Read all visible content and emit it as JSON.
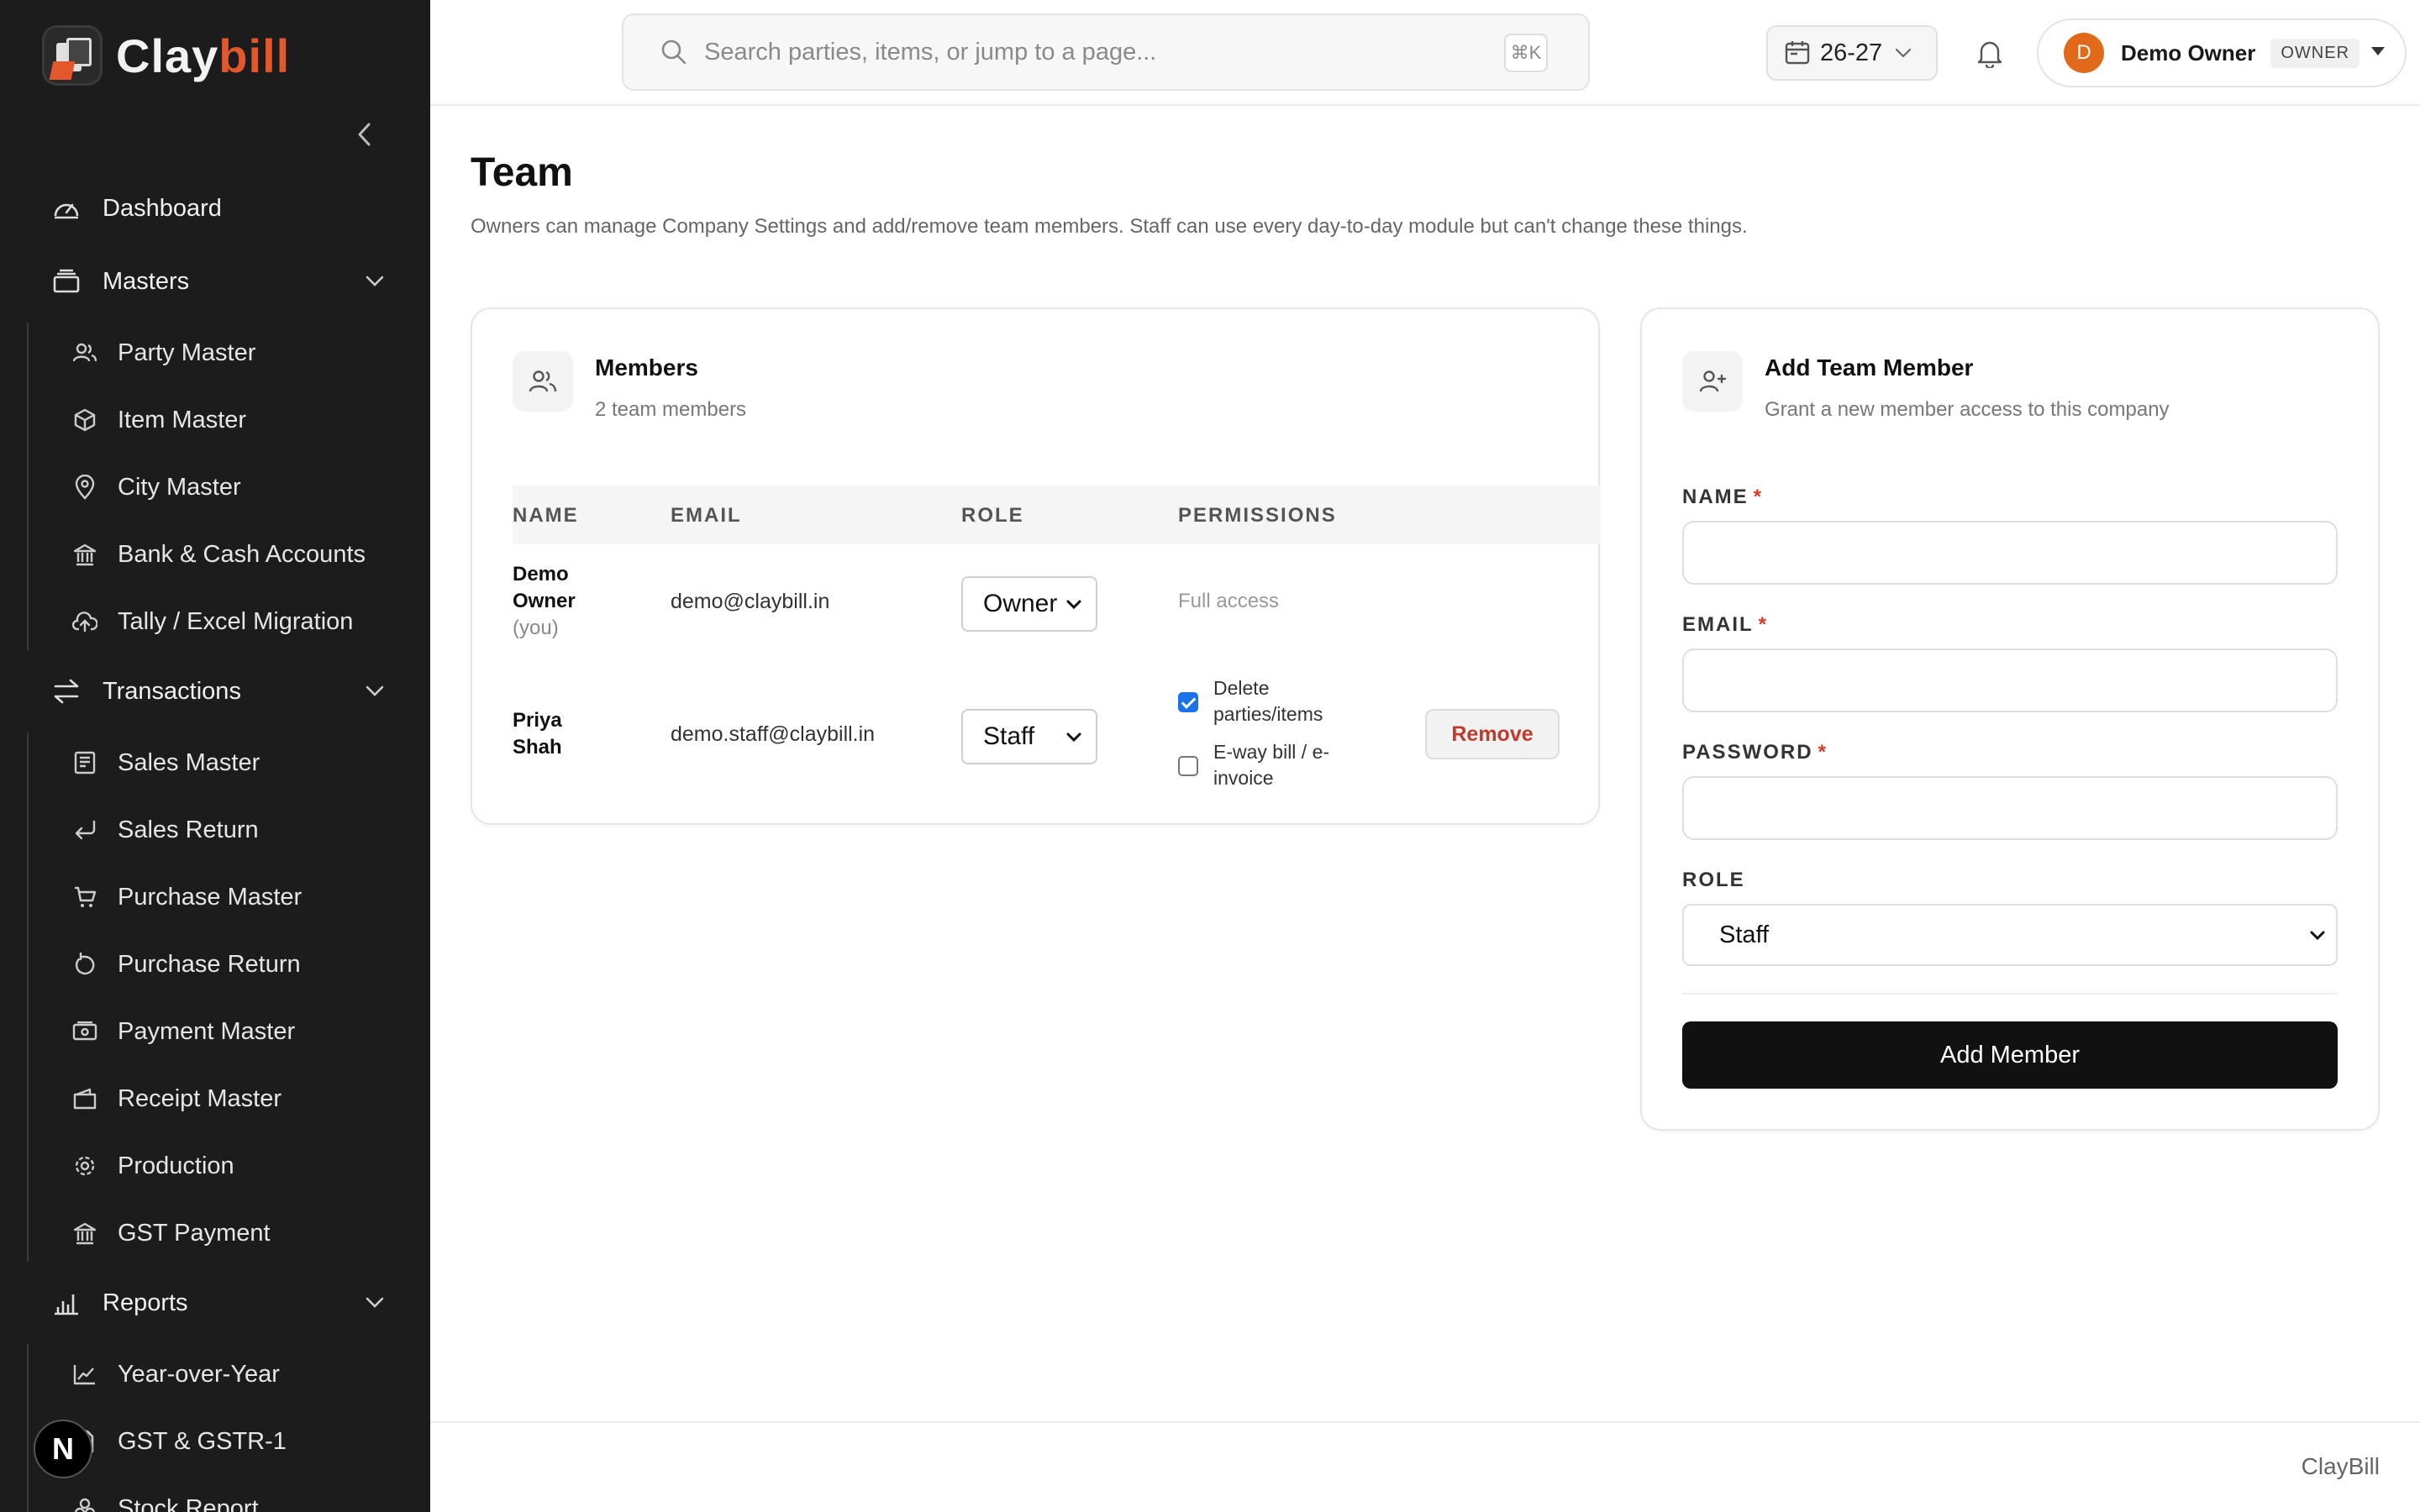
{
  "app": {
    "brand_main": "Clay",
    "brand_accent": "bill",
    "accent_color": "#e2572b"
  },
  "sidebar": {
    "dashboard": {
      "label": "Dashboard",
      "icon": "gauge-icon"
    },
    "masters": {
      "label": "Masters",
      "icon": "layers-icon",
      "items": [
        {
          "label": "Party Master",
          "icon": "users-icon"
        },
        {
          "label": "Item Master",
          "icon": "box-icon"
        },
        {
          "label": "City Master",
          "icon": "map-pin-icon"
        },
        {
          "label": "Bank & Cash Accounts",
          "icon": "bank-icon"
        },
        {
          "label": "Tally / Excel Migration",
          "icon": "cloud-upload-icon"
        }
      ]
    },
    "transactions": {
      "label": "Transactions",
      "icon": "arrows-left-right-icon",
      "items": [
        {
          "label": "Sales Master",
          "icon": "receipt-icon"
        },
        {
          "label": "Sales Return",
          "icon": "return-arrow-icon"
        },
        {
          "label": "Purchase Master",
          "icon": "cart-icon"
        },
        {
          "label": "Purchase Return",
          "icon": "rotate-ccw-icon"
        },
        {
          "label": "Payment Master",
          "icon": "banknote-icon"
        },
        {
          "label": "Receipt Master",
          "icon": "wallet-icon"
        },
        {
          "label": "Production",
          "icon": "gear-icon"
        },
        {
          "label": "GST Payment",
          "icon": "bank-icon"
        }
      ]
    },
    "reports": {
      "label": "Reports",
      "icon": "bar-chart-icon",
      "items": [
        {
          "label": "Year-over-Year",
          "icon": "trending-up-icon"
        },
        {
          "label": "GST & GSTR-1",
          "icon": "file-icon"
        },
        {
          "label": "Stock Report",
          "icon": "stack-icon"
        }
      ]
    },
    "badge_letter": "N"
  },
  "header": {
    "search_placeholder": "Search parties, items, or jump to a page...",
    "shortcut": "⌘K",
    "fiscal_year": "26-27",
    "user_initial": "D",
    "user_name": "Demo Owner",
    "user_role": "OWNER"
  },
  "page": {
    "title": "Team",
    "description": "Owners can manage Company Settings and add/remove team members. Staff can use every day-to-day module but can't change these things."
  },
  "members": {
    "title": "Members",
    "subtitle": "2 team members",
    "columns": {
      "name": "NAME",
      "email": "EMAIL",
      "role": "ROLE",
      "permissions": "PERMISSIONS"
    },
    "rows": [
      {
        "name_line1": "Demo",
        "name_line2": "Owner",
        "name_note": "(you)",
        "email": "demo@claybill.in",
        "role": "Owner",
        "permissions_text": "Full access"
      },
      {
        "name_line1": "Priya",
        "name_line2": "Shah",
        "email": "demo.staff@claybill.in",
        "role": "Staff",
        "perm1_line1": "Delete",
        "perm1_line2": "parties/items",
        "perm1_checked": true,
        "perm2_line1": "E-way bill / e-",
        "perm2_line2": "invoice",
        "perm2_checked": false,
        "action": "Remove"
      }
    ]
  },
  "add_member": {
    "title": "Add Team Member",
    "subtitle": "Grant a new member access to this company",
    "name_label": "NAME",
    "email_label": "EMAIL",
    "password_label": "PASSWORD",
    "role_label": "ROLE",
    "required_mark": "*",
    "name_value": "",
    "email_value": "",
    "password_value": "",
    "role_value": "Staff",
    "submit_label": "Add Member"
  },
  "footer": {
    "brand": "ClayBill"
  }
}
